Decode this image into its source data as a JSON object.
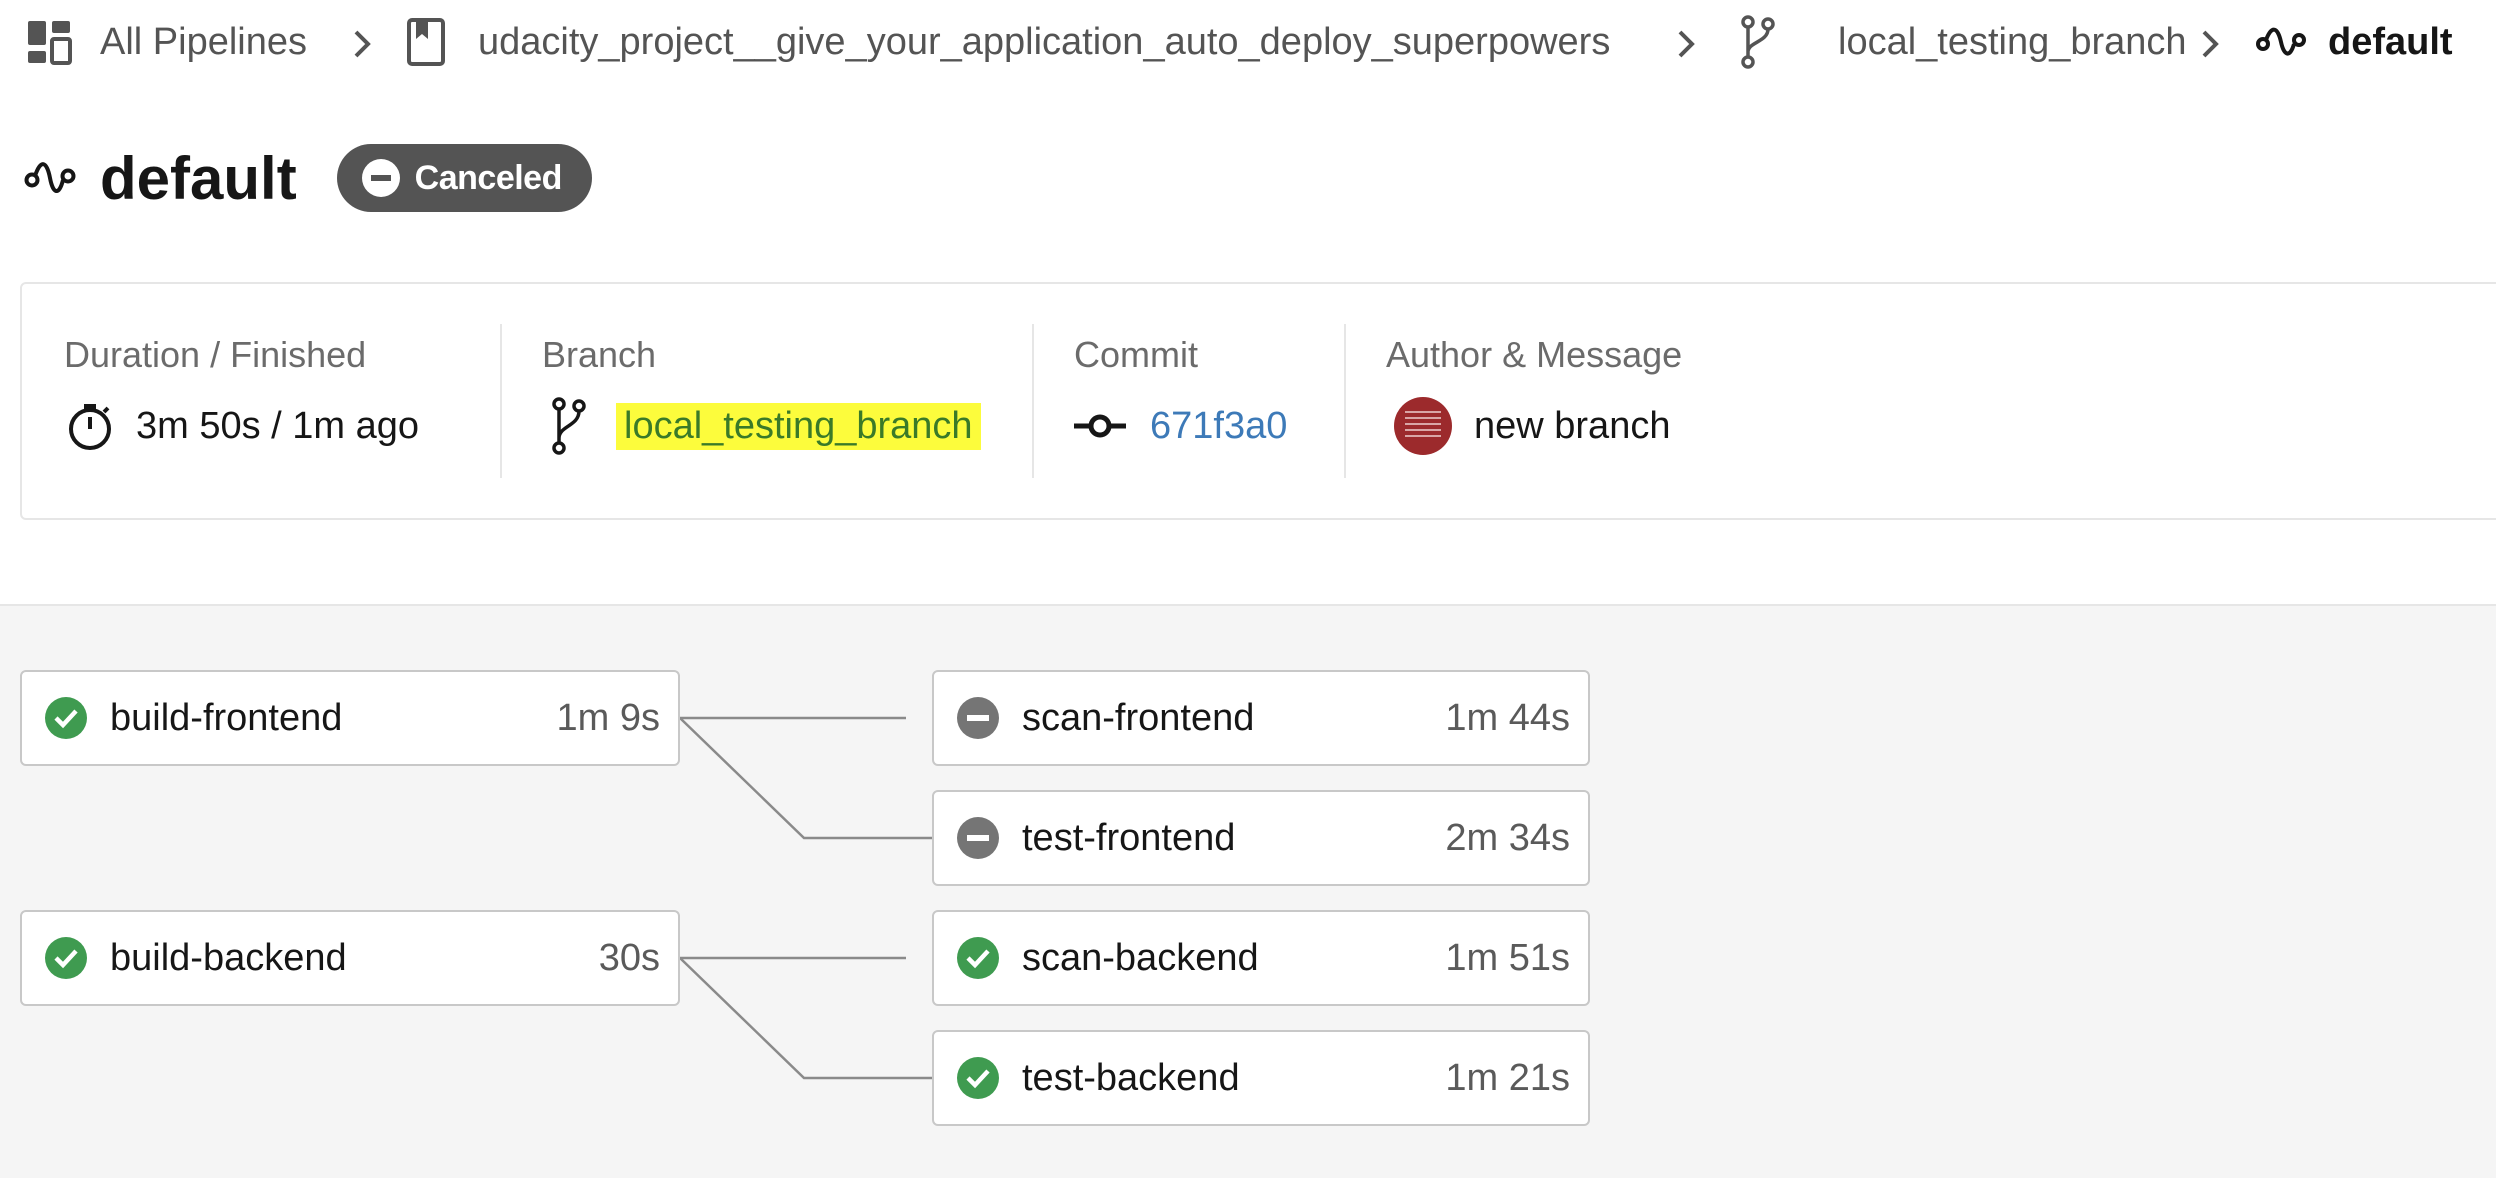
{
  "breadcrumb": {
    "items": [
      {
        "label": "All Pipelines",
        "icon": "dashboard-icon"
      },
      {
        "label": "udacity_project__give_your_application_auto_deploy_superpowers",
        "icon": "bookmark-icon"
      },
      {
        "label": "local_testing_branch",
        "icon": "branch-icon"
      },
      {
        "label": "default",
        "icon": "workflow-icon"
      }
    ]
  },
  "header": {
    "title": "default",
    "status": "Canceled",
    "status_color": "#545454"
  },
  "info": {
    "duration": {
      "label": "Duration / Finished",
      "value": "3m 50s / 1m ago"
    },
    "branch": {
      "label": "Branch",
      "value": "local_testing_branch"
    },
    "commit": {
      "label": "Commit",
      "value": "671f3a0"
    },
    "author": {
      "label": "Author & Message",
      "value": "new branch"
    }
  },
  "jobs": [
    {
      "name": "build-frontend",
      "duration": "1m 9s",
      "status": "success"
    },
    {
      "name": "scan-frontend",
      "duration": "1m 44s",
      "status": "canceled"
    },
    {
      "name": "test-frontend",
      "duration": "2m 34s",
      "status": "canceled"
    },
    {
      "name": "build-backend",
      "duration": "30s",
      "status": "success"
    },
    {
      "name": "scan-backend",
      "duration": "1m 51s",
      "status": "success"
    },
    {
      "name": "test-backend",
      "duration": "1m 21s",
      "status": "success"
    }
  ],
  "colors": {
    "success": "#3f9b50",
    "canceled": "#757575",
    "highlight": "#fcfc3c",
    "link": "#3d7ab8"
  }
}
